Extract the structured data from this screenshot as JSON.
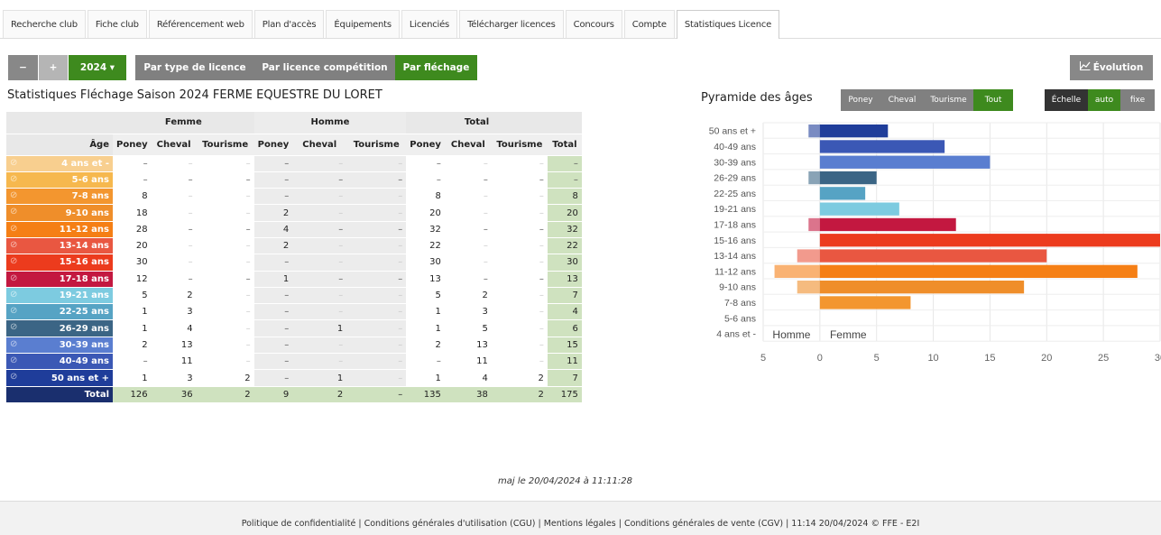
{
  "tabs": [
    "Recherche club",
    "Fiche club",
    "Référencement web",
    "Plan d'accès",
    "Équipements",
    "Licenciés",
    "Télécharger licences",
    "Concours",
    "Compte",
    "Statistiques Licence"
  ],
  "active_tab": 9,
  "toolbar": {
    "minus": "−",
    "plus": "+",
    "year": "2024 ▾",
    "view_modes": [
      "Par type de licence",
      "Par licence compétition",
      "Par fléchage"
    ],
    "evolution": "Évolution"
  },
  "title": "Statistiques Fléchage Saison 2024 FERME EQUESTRE DU LORET",
  "pyramid": {
    "title": "Pyramide des âges",
    "filters": [
      "Poney",
      "Cheval",
      "Tourisme",
      "Tout"
    ],
    "scale_label": "Échelle",
    "scale_options": [
      "auto",
      "fixe"
    ]
  },
  "table": {
    "groups": [
      "Femme",
      "Homme",
      "Total"
    ],
    "age_header": "Âge",
    "columns": [
      "Poney",
      "Cheval",
      "Tourisme",
      "Poney",
      "Cheval",
      "Tourisme",
      "Poney",
      "Cheval",
      "Tourisme",
      "Total"
    ],
    "rows": [
      {
        "age": "4 ans et -",
        "color": "#f8cf8f",
        "cells": [
          "–",
          "–",
          "–",
          "–",
          "–",
          "–",
          "–",
          "–",
          "–",
          "–"
        ]
      },
      {
        "age": "5-6 ans",
        "color": "#f6b84e",
        "cells": [
          "–",
          "–",
          "–",
          "–",
          "–",
          "–",
          "–",
          "–",
          "–",
          "–"
        ]
      },
      {
        "age": "7-8 ans",
        "color": "#f3962f",
        "cells": [
          "8",
          "–",
          "–",
          "–",
          "–",
          "–",
          "8",
          "–",
          "–",
          "8"
        ]
      },
      {
        "age": "9-10 ans",
        "color": "#ef8e2a",
        "cells": [
          "18",
          "–",
          "–",
          "2",
          "–",
          "–",
          "20",
          "–",
          "–",
          "20"
        ]
      },
      {
        "age": "11-12 ans",
        "color": "#f57f15",
        "cells": [
          "28",
          "–",
          "–",
          "4",
          "–",
          "–",
          "32",
          "–",
          "–",
          "32"
        ]
      },
      {
        "age": "13-14 ans",
        "color": "#e95741",
        "cells": [
          "20",
          "–",
          "–",
          "2",
          "–",
          "–",
          "22",
          "–",
          "–",
          "22"
        ]
      },
      {
        "age": "15-16 ans",
        "color": "#ec3b1d",
        "cells": [
          "30",
          "–",
          "–",
          "–",
          "–",
          "–",
          "30",
          "–",
          "–",
          "30"
        ]
      },
      {
        "age": "17-18 ans",
        "color": "#c31840",
        "cells": [
          "12",
          "–",
          "–",
          "1",
          "–",
          "–",
          "13",
          "–",
          "–",
          "13"
        ]
      },
      {
        "age": "19-21 ans",
        "color": "#7dcbe0",
        "cells": [
          "5",
          "2",
          "–",
          "–",
          "–",
          "–",
          "5",
          "2",
          "–",
          "7"
        ]
      },
      {
        "age": "22-25 ans",
        "color": "#56a3c4",
        "cells": [
          "1",
          "3",
          "–",
          "–",
          "–",
          "–",
          "1",
          "3",
          "–",
          "4"
        ]
      },
      {
        "age": "26-29 ans",
        "color": "#3b6585",
        "cells": [
          "1",
          "4",
          "–",
          "–",
          "1",
          "–",
          "1",
          "5",
          "–",
          "6"
        ]
      },
      {
        "age": "30-39 ans",
        "color": "#5a7ed0",
        "cells": [
          "2",
          "13",
          "–",
          "–",
          "–",
          "–",
          "2",
          "13",
          "–",
          "15"
        ]
      },
      {
        "age": "40-49 ans",
        "color": "#3b58b5",
        "cells": [
          "–",
          "11",
          "–",
          "–",
          "–",
          "–",
          "–",
          "11",
          "–",
          "11"
        ]
      },
      {
        "age": "50 ans et +",
        "color": "#1f3d9a",
        "cells": [
          "1",
          "3",
          "2",
          "–",
          "1",
          "–",
          "1",
          "4",
          "2",
          "7"
        ]
      }
    ],
    "total": {
      "label": "Total",
      "cells": [
        "126",
        "36",
        "2",
        "9",
        "2",
        "–",
        "135",
        "38",
        "2",
        "175"
      ]
    }
  },
  "maj": "maj le 20/04/2024 à 11:11:28",
  "footer": "Politique de confidentialité | Conditions générales d'utilisation (CGU) | Mentions légales | Conditions générales de vente (CGV) | 11:14 20/04/2024 © FFE - E2I",
  "chart_data": {
    "type": "bar",
    "orientation": "horizontal",
    "categories": [
      "50 ans et +",
      "40-49 ans",
      "30-39 ans",
      "26-29 ans",
      "22-25 ans",
      "19-21 ans",
      "17-18 ans",
      "15-16 ans",
      "13-14 ans",
      "11-12 ans",
      "9-10 ans",
      "7-8 ans",
      "5-6 ans",
      "4 ans et -"
    ],
    "colors": [
      "#1f3d9a",
      "#3b58b5",
      "#5a7ed0",
      "#3b6585",
      "#56a3c4",
      "#7dcbe0",
      "#c31840",
      "#ec3b1d",
      "#e95741",
      "#f57f15",
      "#ef8e2a",
      "#f3962f",
      "#f6b84e",
      "#f8cf8f"
    ],
    "series": [
      {
        "name": "Homme",
        "values": [
          1,
          0,
          0,
          1,
          0,
          0,
          1,
          0,
          2,
          4,
          2,
          0,
          0,
          0
        ]
      },
      {
        "name": "Femme",
        "values": [
          6,
          11,
          15,
          5,
          4,
          7,
          12,
          30,
          20,
          28,
          18,
          8,
          0,
          0
        ]
      }
    ],
    "xticks": [
      "5",
      "0",
      "5",
      "10",
      "15",
      "20",
      "25",
      "30"
    ],
    "xlim": [
      -5,
      30
    ]
  }
}
